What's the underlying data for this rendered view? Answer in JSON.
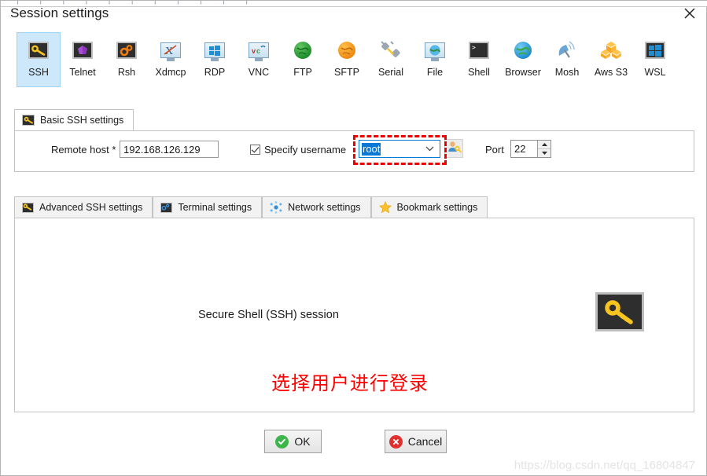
{
  "window": {
    "title": "Session settings",
    "close_label": "✕",
    "close_icon": "close-icon"
  },
  "session_types": [
    {
      "id": "ssh",
      "label": "SSH",
      "icon": "ssh-key-icon",
      "selected": true
    },
    {
      "id": "telnet",
      "label": "Telnet",
      "icon": "telnet-icon",
      "selected": false
    },
    {
      "id": "rsh",
      "label": "Rsh",
      "icon": "rsh-gears-icon",
      "selected": false
    },
    {
      "id": "xdmcp",
      "label": "Xdmcp",
      "icon": "xdmcp-monitor-icon",
      "selected": false
    },
    {
      "id": "rdp",
      "label": "RDP",
      "icon": "rdp-windows-icon",
      "selected": false
    },
    {
      "id": "vnc",
      "label": "VNC",
      "icon": "vnc-monitor-icon",
      "selected": false
    },
    {
      "id": "ftp",
      "label": "FTP",
      "icon": "ftp-globe-icon",
      "selected": false
    },
    {
      "id": "sftp",
      "label": "SFTP",
      "icon": "sftp-globe-icon",
      "selected": false
    },
    {
      "id": "serial",
      "label": "Serial",
      "icon": "serial-plug-icon",
      "selected": false
    },
    {
      "id": "file",
      "label": "File",
      "icon": "file-monitor-icon",
      "selected": false
    },
    {
      "id": "shell",
      "label": "Shell",
      "icon": "shell-prompt-icon",
      "selected": false
    },
    {
      "id": "browser",
      "label": "Browser",
      "icon": "browser-globe-icon",
      "selected": false
    },
    {
      "id": "mosh",
      "label": "Mosh",
      "icon": "mosh-dish-icon",
      "selected": false
    },
    {
      "id": "awss3",
      "label": "Aws S3",
      "icon": "aws-s3-boxes-icon",
      "selected": false
    },
    {
      "id": "wsl",
      "label": "WSL",
      "icon": "wsl-windows-icon",
      "selected": false
    }
  ],
  "basic_tab": {
    "label": "Basic SSH settings",
    "icon": "ssh-key-icon"
  },
  "basic_form": {
    "remote_host_label": "Remote host *",
    "remote_host_value": "192.168.126.129",
    "specify_username_label": "Specify username",
    "specify_username_checked": true,
    "username_value": "root",
    "username_selected": true,
    "user_picker_icon": "user-key-icon",
    "port_label": "Port",
    "port_value": "22",
    "spinner_up_icon": "caret-up-icon",
    "spinner_down_icon": "caret-down-icon",
    "dropdown_icon": "chevron-down-icon"
  },
  "sub_tabs": [
    {
      "id": "advanced",
      "label": "Advanced SSH settings",
      "icon": "ssh-key-icon",
      "active": false
    },
    {
      "id": "terminal",
      "label": "Terminal settings",
      "icon": "terminal-icon",
      "active": false
    },
    {
      "id": "network",
      "label": "Network settings",
      "icon": "network-icon",
      "active": false
    },
    {
      "id": "bookmark",
      "label": "Bookmark settings",
      "icon": "star-icon",
      "active": false
    }
  ],
  "content": {
    "description": "Secure Shell (SSH) session",
    "annotation": "选择用户进行登录",
    "big_icon": "ssh-key-icon"
  },
  "buttons": {
    "ok_label": "OK",
    "ok_icon": "check-circle-icon",
    "cancel_label": "Cancel",
    "cancel_icon": "x-circle-icon"
  },
  "watermark": "https://blog.csdn.net/qq_16804847",
  "colors": {
    "selection_blue": "#0a78d4",
    "highlight_red": "#ee0000",
    "accent_yellow": "#f7c420",
    "ok_green": "#3cb54a",
    "cancel_red": "#e03131"
  }
}
